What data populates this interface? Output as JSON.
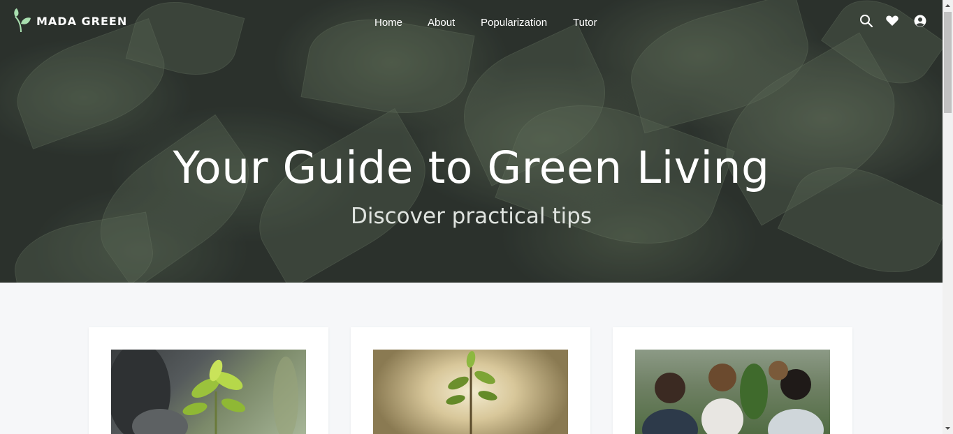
{
  "brand": {
    "name": "MADA GREEN",
    "logo_icon": "leaf-icon",
    "accent": "#a9dfb0"
  },
  "nav": {
    "items": [
      {
        "label": "Home"
      },
      {
        "label": "About"
      },
      {
        "label": "Popularization"
      },
      {
        "label": "Tutor"
      }
    ],
    "icons": [
      "search-icon",
      "heart-icon",
      "user-circle-icon"
    ]
  },
  "hero": {
    "title": "Your Guide to Green Living",
    "subtitle": "Discover practical tips"
  },
  "cards": [
    {
      "image": "planting-seedling-gloves-image"
    },
    {
      "image": "sapling-in-light-image"
    },
    {
      "image": "group-gardening-image"
    }
  ],
  "colors": {
    "page_bg": "#f6f7f9",
    "card_bg": "#ffffff",
    "hero_text": "#ffffff"
  }
}
